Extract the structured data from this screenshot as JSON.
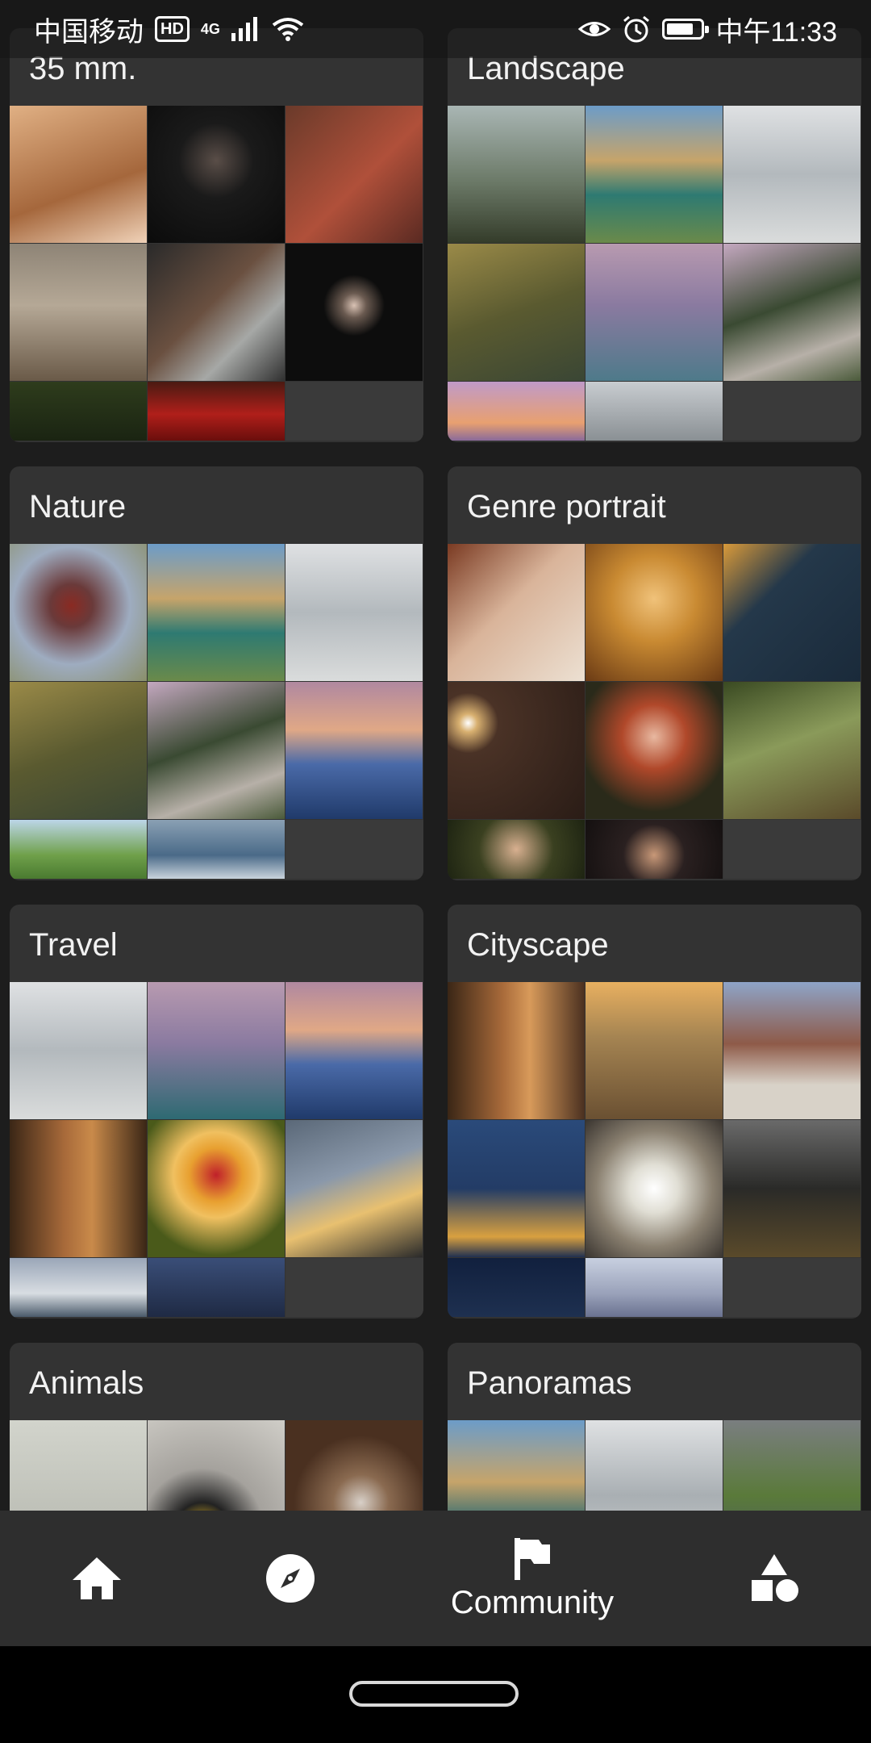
{
  "status_bar": {
    "carrier": "中国移动",
    "hd_badge": "HD",
    "network": "4G",
    "time": "中午11:33",
    "battery_level": 0.8
  },
  "categories": [
    {
      "title": "35 mm.",
      "thumbs": [
        "#c9925f",
        "#141414",
        "#8c3e32",
        "#8a7e70",
        "#3d3a37",
        "#0d0d0d",
        "#2c3c1a",
        "#8e1b19"
      ]
    },
    {
      "title": "Landscape",
      "thumbs": [
        "#6d7866",
        "#5f8ea2",
        "#c4c7cb",
        "#7a6a3a",
        "#9a8aa2",
        "#5a6a7e",
        "#c1879a",
        "#aab1b5"
      ]
    },
    {
      "title": "Nature",
      "thumbs": [
        "#7e8fa2",
        "#5f8ea2",
        "#c9ccd0",
        "#6f6a3c",
        "#7d6f8a",
        "#4e6a9e",
        "#6fa04a",
        "#5f7f98"
      ]
    },
    {
      "title": "Genre portrait",
      "thumbs": [
        "#c7ab92",
        "#c98a32",
        "#24384a",
        "#4a3226",
        "#7a2c1e",
        "#6b7a4a",
        "#2f3620",
        "#1b1616"
      ]
    },
    {
      "title": "Travel",
      "thumbs": [
        "#c4c7cb",
        "#8e7f8d",
        "#4d6aa8",
        "#5a3f2c",
        "#d08a2a",
        "#5a6878",
        "#9aa6b8",
        "#1f2a44"
      ]
    },
    {
      "title": "Cityscape",
      "thumbs": [
        "#7a5a3a",
        "#a58452",
        "#8e6b58",
        "#233c66",
        "#d5d2c8",
        "#3a3a38",
        "#11203e",
        "#9aa2ba"
      ]
    },
    {
      "title": "Animals",
      "thumbs": [
        "#c9c8c2",
        "#a5a29d",
        "#4a3020"
      ]
    },
    {
      "title": "Panoramas",
      "thumbs": [
        "#5f8ea2",
        "#b9bdc1",
        "#5d6160"
      ]
    }
  ],
  "nav": {
    "home": "home-icon",
    "explore": "compass-icon",
    "community_label": "Community",
    "shapes": "shapes-icon"
  }
}
